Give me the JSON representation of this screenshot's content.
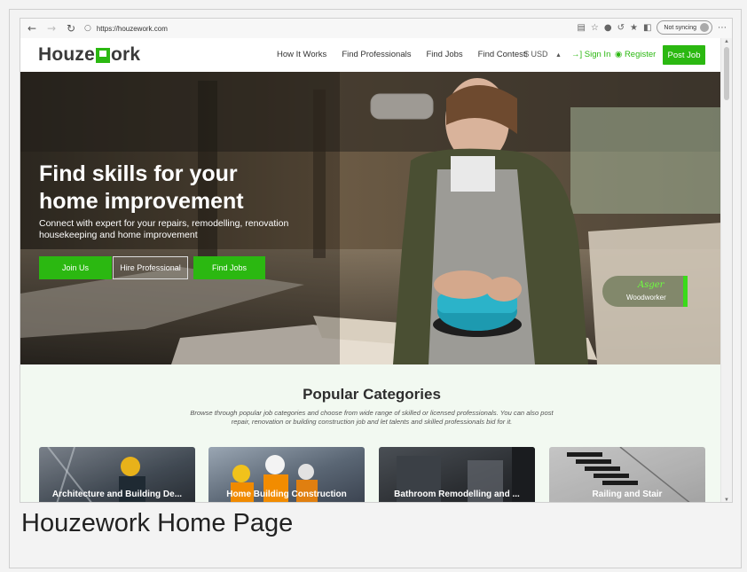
{
  "browser": {
    "url": "https://houzework.com",
    "sync_label": "Not syncing"
  },
  "site": {
    "logo_left": "Houze",
    "logo_right": "ork",
    "nav": [
      "How It Works",
      "Find Professionals",
      "Find Jobs",
      "Find Contest"
    ],
    "currency": "$ USD",
    "sign_in": "Sign In",
    "register": "Register",
    "post_job": "Post Job"
  },
  "hero": {
    "title": "Find skills for your home improvement",
    "subtitle": "Connect with expert for your repairs, remodelling, renovation housekeeping and home improvement",
    "buttons": [
      "Join Us",
      "Hire Professional",
      "Find Jobs"
    ],
    "badge_name": "Asger",
    "badge_role": "Woodworker"
  },
  "categories": {
    "title": "Popular Categories",
    "subtitle": "Browse through popular job categories and choose from wide range of skilled or licensed professionals. You can also post repair, renovation or building construction job and let talents and skilled professionals bid for it.",
    "items": [
      "Architecture and Building De...",
      "Home Building Construction",
      "Bathroom Remodelling and ...",
      "Railing and Stair"
    ]
  },
  "caption": "Houzework Home Page",
  "colors": {
    "brand_green": "#2bb811",
    "badge_name": "#6eff3f"
  }
}
